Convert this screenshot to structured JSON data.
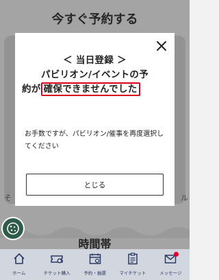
{
  "page": {
    "title": "今すぐ予約する",
    "left_fragment": "そ",
    "right_fragment": "ル",
    "section_title": "時間帯"
  },
  "dialog": {
    "heading_line1": "＜ 当日登録 ＞",
    "heading_line2": "パビリオン/イベントの予",
    "heading_line3_prefix": "約が",
    "heading_line3_highlight": "確保できませんでした",
    "body": "お手数ですが、パビリオン/催事を再度選択してください",
    "close_button": "とじる",
    "close_icon": "close-icon"
  },
  "fab": {
    "icon": "cookie-icon"
  },
  "tabbar": {
    "items": [
      {
        "label": "ホーム",
        "icon": "home-icon"
      },
      {
        "label": "チケット購入",
        "icon": "ticket-icon"
      },
      {
        "label": "予約・抽選",
        "icon": "calendar-icon"
      },
      {
        "label": "マイチケット",
        "icon": "clipboard-icon"
      },
      {
        "label": "メッセージ",
        "icon": "mail-icon"
      }
    ]
  },
  "colors": {
    "highlight_border": "#d8001c",
    "tabbar_bg": "#d2d6de",
    "tab_icon": "#2a3a66",
    "fab_bg": "#2f5b49",
    "badge": "#e0002a"
  }
}
